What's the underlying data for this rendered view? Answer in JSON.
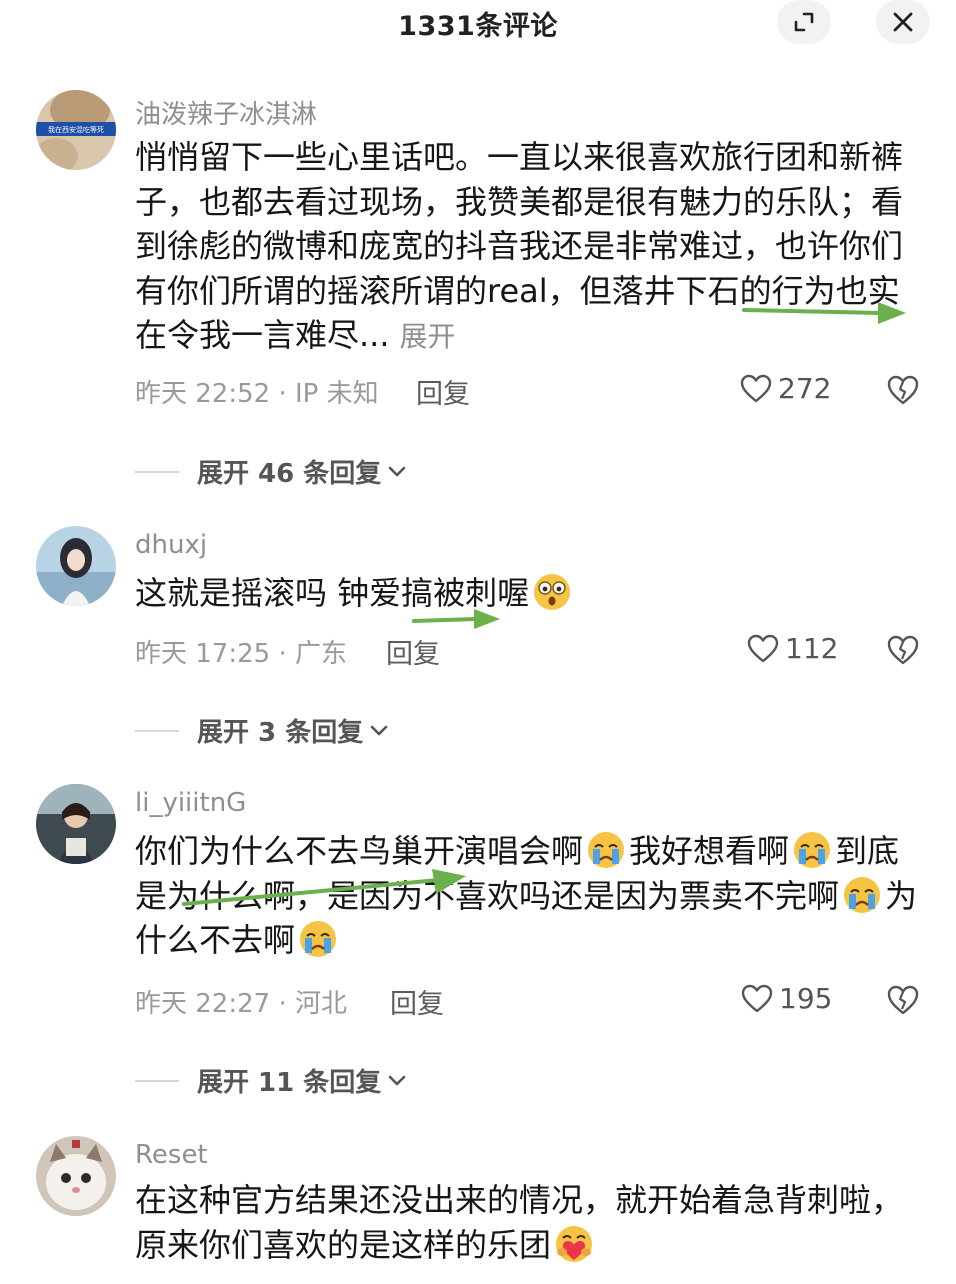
{
  "header": {
    "title": "1331条评论"
  },
  "comments": [
    {
      "author": "油泼辣子冰淇淋",
      "avatar_banner": "我在西安混吃等死",
      "text": "悄悄留下一些心里话吧。一直以来很喜欢旅行团和新裤子，也都去看过现场，我赞美都是很有魅力的乐队；看到徐彪的微博和庞宽的抖音我还是非常难过，也许你们有你们所谓的摇滚所谓的real，但落井下石的行为也实在令我一言难尽...",
      "expand": "展开",
      "meta": "昨天 22:52 · IP 未知",
      "reply": "回复",
      "likes": "272",
      "replies": "展开 46 条回复"
    },
    {
      "author": "dhuxj",
      "text": "这就是摇滚吗 钟爱搞被刺喔",
      "meta": "昨天 17:25 · 广东",
      "reply": "回复",
      "likes": "112",
      "replies": "展开 3 条回复"
    },
    {
      "author": "li_yiiitnG",
      "text_a": "你们为什么不去鸟巢开演唱会啊",
      "text_b": "我好想看啊",
      "text_c": "到底是为什么啊，是因为不喜欢吗还是因为票卖不完啊",
      "text_d": "为什么不去啊",
      "meta": "昨天 22:27 · 河北",
      "reply": "回复",
      "likes": "195",
      "replies": "展开 11 条回复"
    },
    {
      "author": "Reset",
      "text": "在这种官方结果还没出来的情况，就开始着急背刺啦，原来你们喜欢的是这样的乐团"
    }
  ],
  "icons": {
    "expand": "expand-icon",
    "close": "close-icon",
    "like": "heart-outline-icon",
    "dislike": "broken-heart-icon",
    "chevron": "chevron-down-icon"
  },
  "colors": {
    "annotation_arrow": "#6ab04c",
    "meta_gray": "#9a9a9a",
    "emoji_yellow": "#f6c343"
  }
}
